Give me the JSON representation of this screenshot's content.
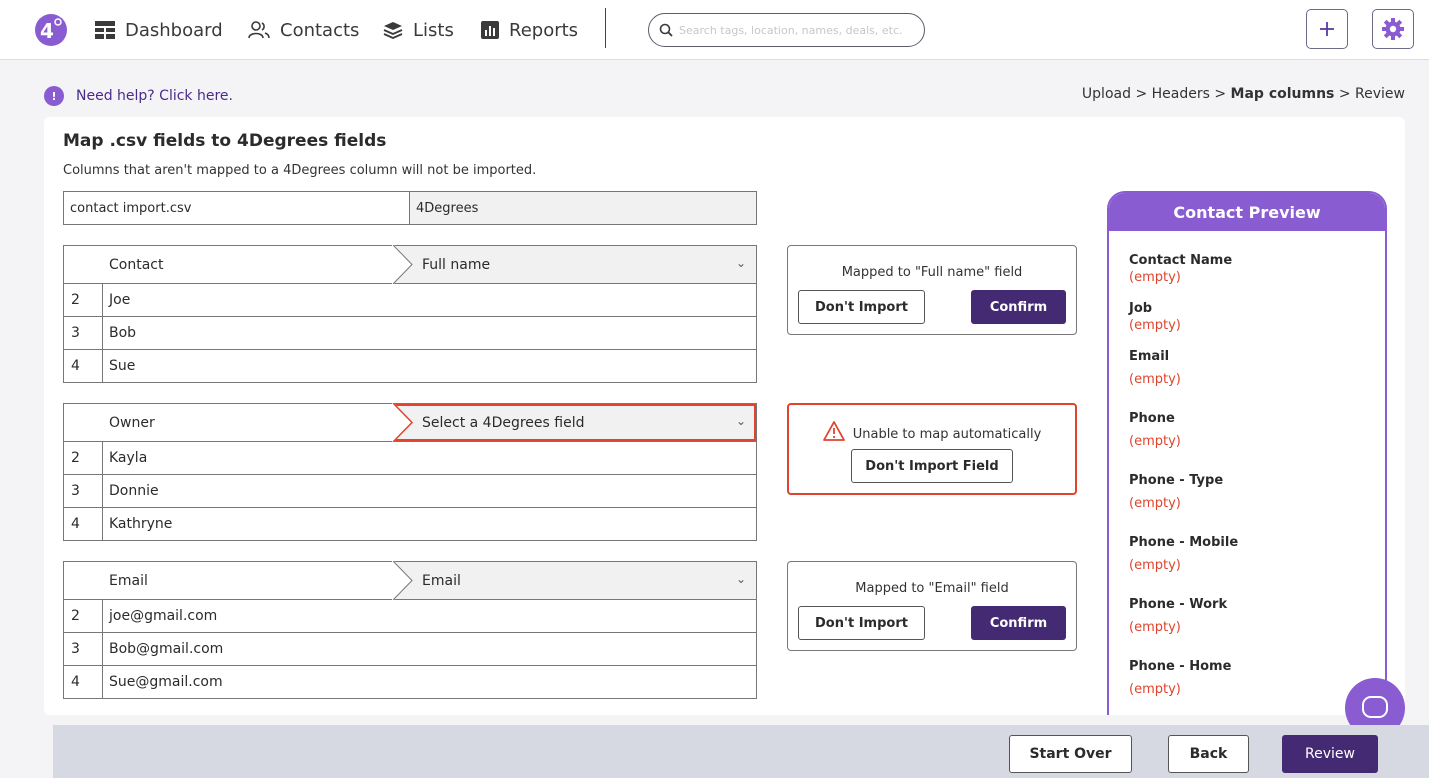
{
  "nav": {
    "items": [
      {
        "label": "Dashboard",
        "icon": "dashboard-icon"
      },
      {
        "label": "Contacts",
        "icon": "contacts-icon"
      },
      {
        "label": "Lists",
        "icon": "lists-icon"
      },
      {
        "label": "Reports",
        "icon": "reports-icon"
      }
    ],
    "search_placeholder": "Search tags, location, names, deals, etc.",
    "add_icon": "plus-icon",
    "settings_icon": "gear-icon"
  },
  "help": {
    "label": "Need help? Click here."
  },
  "breadcrumb": {
    "step1": "Upload",
    "step2": "Headers",
    "current": "Map columns",
    "step4": "Review",
    "sep": ">"
  },
  "main": {
    "title": "Map .csv fields to 4Degrees fields",
    "subtitle": "Columns that aren't mapped to a 4Degrees column will not be imported.",
    "header_left": "contact import.csv",
    "header_right": "4Degrees",
    "mappings": [
      {
        "source": "Contact",
        "target": "Full name",
        "error": false,
        "rows": [
          {
            "n": "2",
            "v": "Joe"
          },
          {
            "n": "3",
            "v": "Bob"
          },
          {
            "n": "4",
            "v": "Sue"
          }
        ],
        "status": "Mapped to \"Full name\" field",
        "dont_import": "Don't Import",
        "confirm": "Confirm"
      },
      {
        "source": "Owner",
        "target": "Select a 4Degrees field",
        "error": true,
        "rows": [
          {
            "n": "2",
            "v": "Kayla"
          },
          {
            "n": "3",
            "v": "Donnie"
          },
          {
            "n": "4",
            "v": "Kathryne"
          }
        ],
        "status": "Unable to map automatically",
        "dont_import": "Don't Import Field"
      },
      {
        "source": "Email",
        "target": "Email",
        "error": false,
        "rows": [
          {
            "n": "2",
            "v": "joe@gmail.com"
          },
          {
            "n": "3",
            "v": "Bob@gmail.com"
          },
          {
            "n": "4",
            "v": "Sue@gmail.com"
          }
        ],
        "status": "Mapped to \"Email\" field",
        "dont_import": "Don't Import",
        "confirm": "Confirm"
      }
    ]
  },
  "preview": {
    "title": "Contact Preview",
    "fields": [
      {
        "label": "Contact Name",
        "value": "(empty)"
      },
      {
        "label": "Job",
        "value": "(empty)"
      },
      {
        "label": "Email",
        "value": "(empty)"
      },
      {
        "label": "Phone",
        "value": "(empty)"
      },
      {
        "label": "Phone - Type",
        "value": "(empty)"
      },
      {
        "label": "Phone - Mobile",
        "value": "(empty)"
      },
      {
        "label": "Phone - Work",
        "value": "(empty)"
      },
      {
        "label": "Phone - Home",
        "value": "(empty)"
      }
    ]
  },
  "footer": {
    "start_over": "Start Over",
    "back": "Back",
    "review": "Review"
  },
  "colors": {
    "brand": "#432a72",
    "accent": "#8a5cd1",
    "error": "#e0442d"
  }
}
